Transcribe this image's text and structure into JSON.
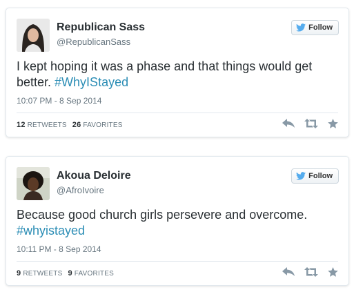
{
  "tweets": [
    {
      "name": "Republican Sass",
      "handle": "@RepublicanSass",
      "follow_label": "Follow",
      "text_plain": "I kept hoping it was a phase and that things would get better. ",
      "hashtag": "#WhyIStayed",
      "time": "10:07 PM - 8 Sep 2014",
      "retweets_count": "12",
      "retweets_label": "RETWEETS",
      "favorites_count": "26",
      "favorites_label": "FAVORITES"
    },
    {
      "name": "Akoua Deloire",
      "handle": "@AfroIvoire",
      "follow_label": "Follow",
      "text_plain": "Because good church girls persevere and overcome. ",
      "hashtag": "#whyistayed",
      "time": "10:11 PM - 8 Sep 2014",
      "retweets_count": "9",
      "retweets_label": "RETWEETS",
      "favorites_count": "9",
      "favorites_label": "FAVORITES"
    }
  ],
  "icons": {
    "follow": "twitter-bird-icon",
    "reply": "reply-icon",
    "retweet": "retweet-icon",
    "favorite": "star-icon"
  },
  "colors": {
    "hashtag": "#2b8db5",
    "twitter_blue": "#55acee",
    "action_gray": "#8899a6"
  }
}
